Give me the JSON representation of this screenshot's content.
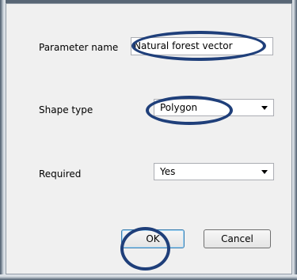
{
  "fields": {
    "parameter_name": {
      "label": "Parameter name",
      "value": "Natural forest vector"
    },
    "shape_type": {
      "label": "Shape type",
      "selected": "Polygon"
    },
    "required": {
      "label": "Required",
      "selected": "Yes"
    }
  },
  "buttons": {
    "ok": "OK",
    "cancel": "Cancel"
  },
  "colors": {
    "annotation_ring": "#1f3f7a",
    "dialog_background": "#f0f0f0"
  },
  "icons": {
    "dropdown": "chevron-down-icon"
  }
}
